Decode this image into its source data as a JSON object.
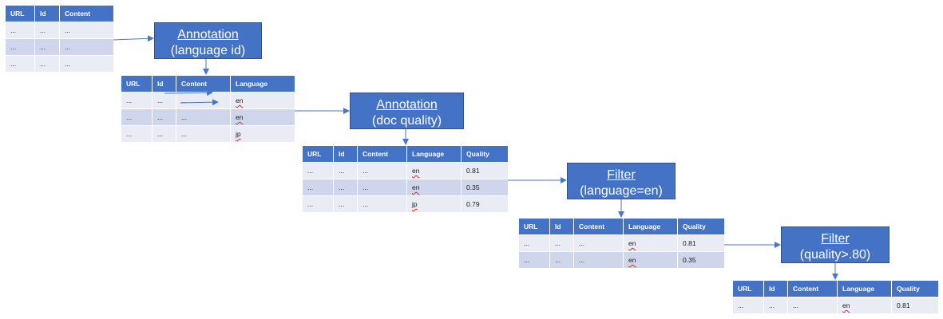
{
  "columns_base": [
    "URL",
    "Id",
    "Content"
  ],
  "columns_lang": [
    "URL",
    "Id",
    "Content",
    "Language"
  ],
  "columns_quality": [
    "URL",
    "Id",
    "Content",
    "Language",
    "Quality"
  ],
  "table1": [
    [
      "...",
      "...",
      "..."
    ],
    [
      "...",
      "...",
      "..."
    ],
    [
      "...",
      "...",
      "..."
    ]
  ],
  "table2": [
    [
      "...",
      "...",
      "...",
      "en"
    ],
    [
      "...",
      "...",
      "...",
      "en"
    ],
    [
      "...",
      "...",
      "...",
      "jp"
    ]
  ],
  "table3": [
    [
      "...",
      "...",
      "...",
      "en",
      "0.81"
    ],
    [
      "...",
      "...",
      "...",
      "en",
      "0.35"
    ],
    [
      "...",
      "...",
      "...",
      "jp",
      "0.79"
    ]
  ],
  "table4": [
    [
      "...",
      "...",
      "...",
      "en",
      "0.81"
    ],
    [
      "...",
      "...",
      "...",
      "en",
      "0.35"
    ]
  ],
  "table5": [
    [
      "...",
      "...",
      "...",
      "en",
      "0.81"
    ]
  ],
  "steps": [
    {
      "title": "Annotation",
      "subtitle": "(language id)"
    },
    {
      "title": "Annotation",
      "subtitle": "(doc quality)"
    },
    {
      "title": "Filter",
      "subtitle": "(language=en)"
    },
    {
      "title": "Filter",
      "subtitle": "(quality>.80)"
    }
  ],
  "colors": {
    "header": "#4472c4",
    "row_dark": "#cfd5ea",
    "row_light": "#e9ebf5",
    "arrow": "#4a76c4"
  }
}
